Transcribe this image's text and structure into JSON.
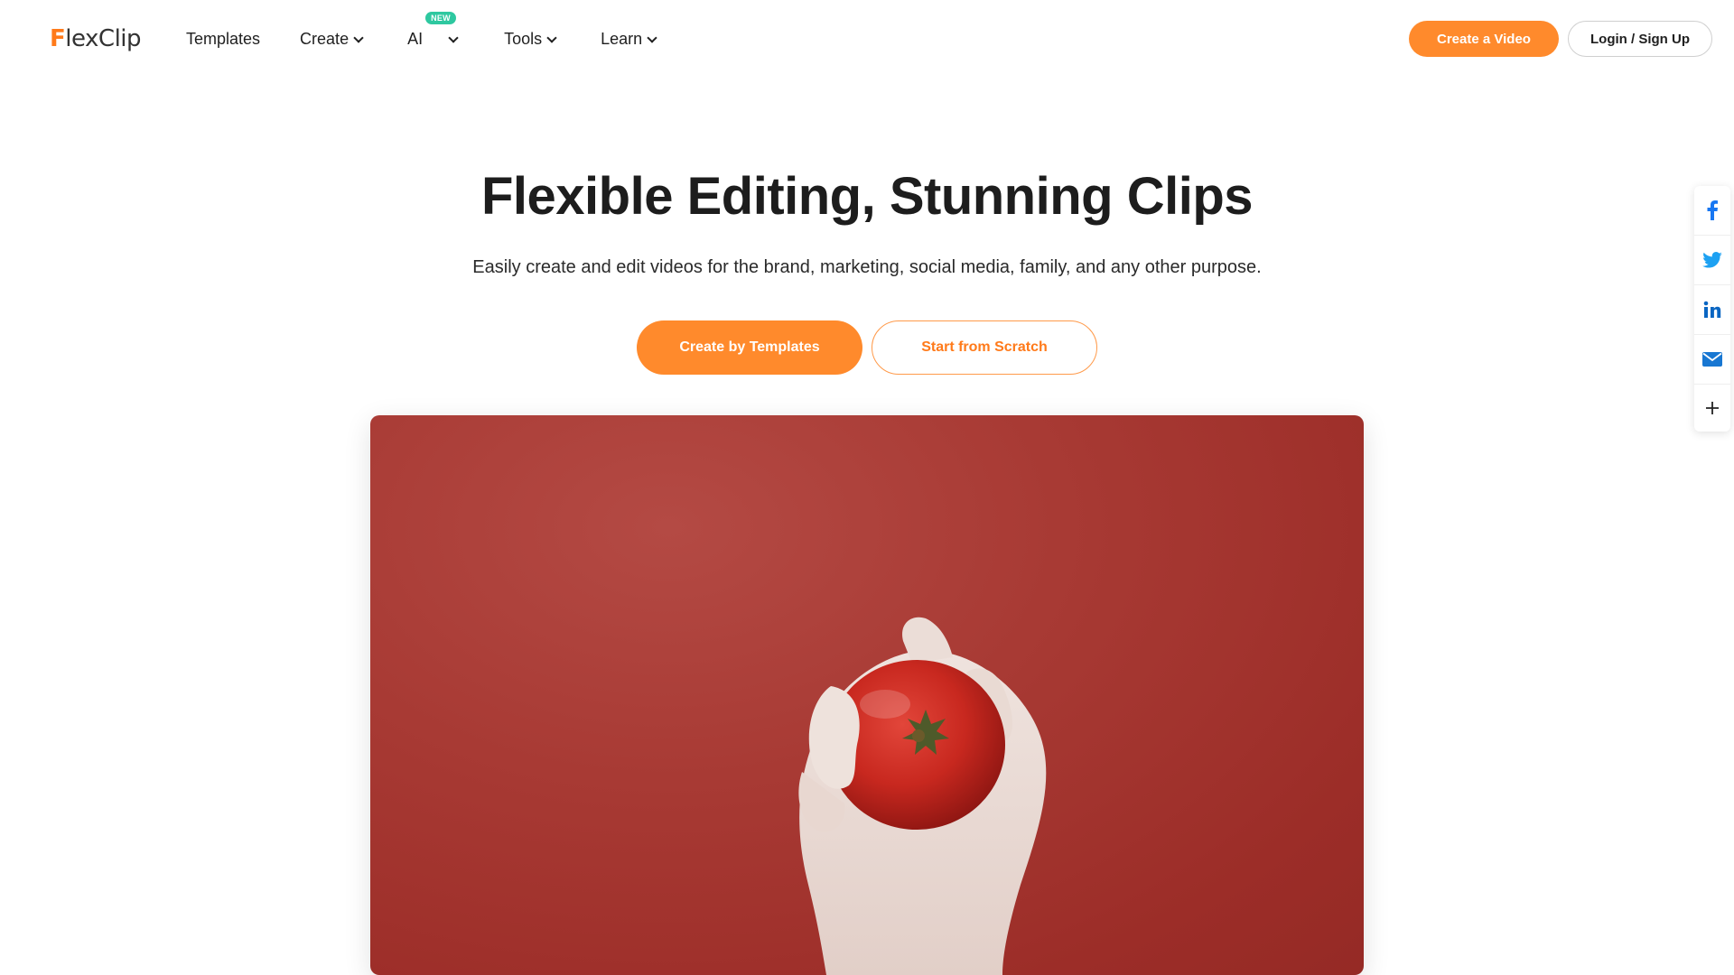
{
  "header": {
    "logo_text_f": "F",
    "logo_text_rest": "lexClip",
    "nav": [
      {
        "label": "Templates"
      },
      {
        "label": "Create"
      },
      {
        "label": "AI",
        "badge": "NEW"
      },
      {
        "label": "Tools"
      },
      {
        "label": "Learn"
      }
    ],
    "create_video_label": "Create a Video",
    "login_label": "Login / Sign Up"
  },
  "hero": {
    "title": "Flexible Editing, Stunning Clips",
    "subtitle": "Easily create and edit videos for the brand, marketing, social media, family, and any other purpose.",
    "primary_button": "Create by Templates",
    "secondary_button": "Start from Scratch"
  },
  "video": {
    "subject": "hand holding tomato on red background"
  },
  "share": {
    "items": [
      "facebook-icon",
      "twitter-icon",
      "linkedin-icon",
      "email-icon",
      "plus-icon"
    ]
  },
  "colors": {
    "accent": "#ff8a2c",
    "badge": "#2ec8a0",
    "facebook": "#1877f2",
    "twitter": "#1da1f2",
    "linkedin": "#0a66c2"
  }
}
